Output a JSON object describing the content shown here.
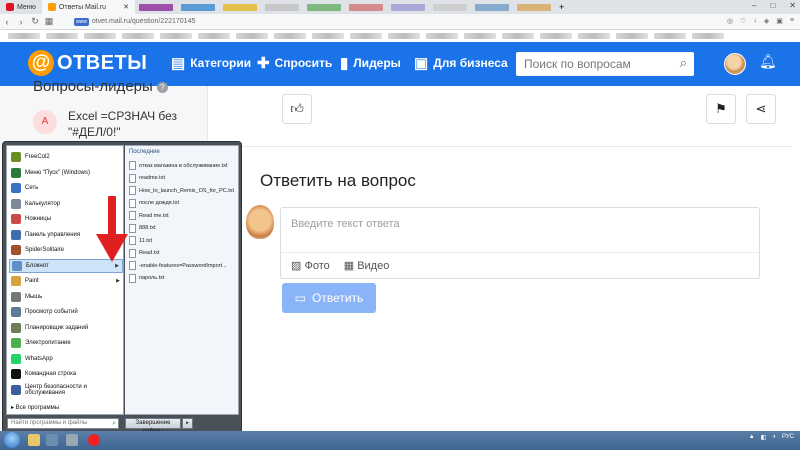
{
  "browser": {
    "tabs": [
      {
        "label": "Меню",
        "active": false
      },
      {
        "label": "Ответы Mail.ru",
        "active": true
      }
    ],
    "close_glyph": "✕",
    "new_tab_glyph": "+",
    "url": "otvet.mail.ru/question/222170145",
    "url_badge": "www",
    "window_controls": [
      "–",
      "□",
      "✕"
    ]
  },
  "site": {
    "logo_at": "@",
    "logo_name": "ОТВЕТЫ",
    "nav": [
      {
        "label": "Категории",
        "icon": "grid-icon"
      },
      {
        "label": "Спросить",
        "icon": "plus-icon"
      },
      {
        "label": "Лидеры",
        "icon": "bar-chart-icon"
      },
      {
        "label": "Для бизнеса",
        "icon": "briefcase-icon"
      }
    ],
    "search_placeholder": "Поиск по вопросам",
    "brand_color": "#1a73e8",
    "accent_color": "#ff9e00"
  },
  "leaders": {
    "title": "Вопросы-лидеры",
    "help_glyph": "?",
    "item_avatar_letter": "A",
    "item_text": "Excel =СРЗНАЧ без \"#ДЕЛ/0!\""
  },
  "answer": {
    "title": "Ответить на вопрос",
    "input_placeholder": "Введите текст ответа",
    "photo_label": "Фото",
    "video_label": "Видео",
    "submit_label": "Ответить"
  },
  "start_menu": {
    "programs": [
      {
        "label": "FreeCol2",
        "color": "#6b8e23",
        "has_arrow": false
      },
      {
        "label": "Меню \"Пуск\" (Windows)",
        "color": "#2b7a3e",
        "has_arrow": false
      },
      {
        "label": "Сеть",
        "color": "#3b73c4",
        "has_arrow": false
      },
      {
        "label": "Калькулятор",
        "color": "#7d8b98",
        "has_arrow": false
      },
      {
        "label": "Ножницы",
        "color": "#c94a4a",
        "has_arrow": false
      },
      {
        "label": "Панель управления",
        "color": "#3d6fb0",
        "has_arrow": false
      },
      {
        "label": "SpiderSolitaire",
        "color": "#a0522d",
        "has_arrow": false
      },
      {
        "label": "Блокнот",
        "color": "#5f8fc4",
        "has_arrow": true,
        "selected": true
      },
      {
        "label": "Paint",
        "color": "#d7a23a",
        "has_arrow": true
      },
      {
        "label": "Мышь",
        "color": "#777777",
        "has_arrow": false
      },
      {
        "label": "Просмотр событий",
        "color": "#5d7a99",
        "has_arrow": false
      },
      {
        "label": "Планировщик заданий",
        "color": "#6a7f5a",
        "has_arrow": false
      },
      {
        "label": "Электропитание",
        "color": "#4caf50",
        "has_arrow": false
      },
      {
        "label": "WhatsApp",
        "color": "#25d366",
        "has_arrow": false
      },
      {
        "label": "Командная строка",
        "color": "#111111",
        "has_arrow": false
      },
      {
        "label": "Центр безопасности и обслуживания",
        "color": "#3a5f9c",
        "has_arrow": false
      }
    ],
    "all_programs": "Все программы",
    "recent_title": "Последние",
    "recent": [
      "отказ магазина в обслуживание.txt",
      "readme.txt",
      "How_to_launch_Remix_OS_for_PC.txt",
      "после дождя.txt",
      "Read me.txt",
      "888.txt",
      "11.txt",
      "Read.txt",
      "-enable-features=PasswordImport...",
      "пароль.txt"
    ],
    "search_placeholder": "Найти программы и файлы",
    "shutdown_label": "Завершение работы"
  },
  "taskbar": {
    "tray_language": "РУС"
  },
  "annotation_color": "#e02020"
}
